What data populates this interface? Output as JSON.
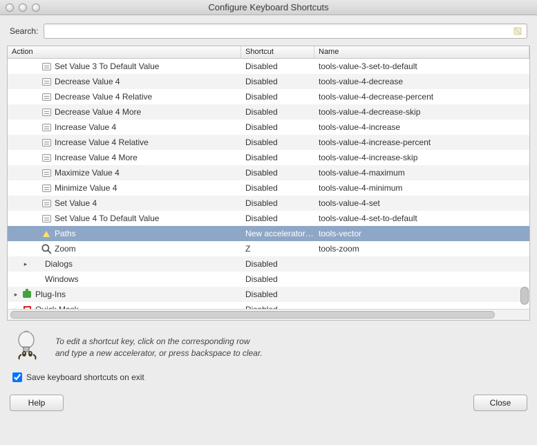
{
  "window": {
    "title": "Configure Keyboard Shortcuts"
  },
  "search": {
    "label": "Search:",
    "value": "",
    "placeholder": ""
  },
  "columns": {
    "action": "Action",
    "shortcut": "Shortcut",
    "name": "Name"
  },
  "rows": [
    {
      "indent": 2,
      "iconType": "kbd",
      "expander": "",
      "action": "Set Value 3 To Default Value",
      "shortcut": "Disabled",
      "name": "tools-value-3-set-to-default",
      "alt": false
    },
    {
      "indent": 2,
      "iconType": "kbd",
      "expander": "",
      "action": "Decrease Value 4",
      "shortcut": "Disabled",
      "name": "tools-value-4-decrease",
      "alt": true
    },
    {
      "indent": 2,
      "iconType": "kbd",
      "expander": "",
      "action": "Decrease Value 4 Relative",
      "shortcut": "Disabled",
      "name": "tools-value-4-decrease-percent",
      "alt": false
    },
    {
      "indent": 2,
      "iconType": "kbd",
      "expander": "",
      "action": "Decrease Value 4 More",
      "shortcut": "Disabled",
      "name": "tools-value-4-decrease-skip",
      "alt": true
    },
    {
      "indent": 2,
      "iconType": "kbd",
      "expander": "",
      "action": "Increase Value 4",
      "shortcut": "Disabled",
      "name": "tools-value-4-increase",
      "alt": false
    },
    {
      "indent": 2,
      "iconType": "kbd",
      "expander": "",
      "action": "Increase Value 4 Relative",
      "shortcut": "Disabled",
      "name": "tools-value-4-increase-percent",
      "alt": true
    },
    {
      "indent": 2,
      "iconType": "kbd",
      "expander": "",
      "action": "Increase Value 4 More",
      "shortcut": "Disabled",
      "name": "tools-value-4-increase-skip",
      "alt": false
    },
    {
      "indent": 2,
      "iconType": "kbd",
      "expander": "",
      "action": "Maximize Value 4",
      "shortcut": "Disabled",
      "name": "tools-value-4-maximum",
      "alt": true
    },
    {
      "indent": 2,
      "iconType": "kbd",
      "expander": "",
      "action": "Minimize Value 4",
      "shortcut": "Disabled",
      "name": "tools-value-4-minimum",
      "alt": false
    },
    {
      "indent": 2,
      "iconType": "kbd",
      "expander": "",
      "action": "Set Value 4",
      "shortcut": "Disabled",
      "name": "tools-value-4-set",
      "alt": true
    },
    {
      "indent": 2,
      "iconType": "kbd",
      "expander": "",
      "action": "Set Value 4 To Default Value",
      "shortcut": "Disabled",
      "name": "tools-value-4-set-to-default",
      "alt": false
    },
    {
      "indent": 2,
      "iconType": "paths",
      "expander": "",
      "action": "Paths",
      "shortcut": "New accelerator…",
      "name": "tools-vector",
      "alt": true,
      "selected": true
    },
    {
      "indent": 2,
      "iconType": "zoom",
      "expander": "",
      "action": "Zoom",
      "shortcut": "Z",
      "name": "tools-zoom",
      "alt": false
    },
    {
      "indent": 1,
      "iconType": "",
      "expander": "▸",
      "action": "Dialogs",
      "shortcut": "Disabled",
      "name": "",
      "alt": true
    },
    {
      "indent": 1,
      "iconType": "",
      "expander": "",
      "action": "Windows",
      "shortcut": "Disabled",
      "name": "",
      "alt": false
    },
    {
      "indent": 0,
      "iconType": "plugin",
      "expander": "▸",
      "action": "Plug-Ins",
      "shortcut": "Disabled",
      "name": "",
      "alt": true
    },
    {
      "indent": 0,
      "iconType": "quickmask",
      "expander": "▸",
      "action": "Quick Mask",
      "shortcut": "Disabled",
      "name": "",
      "alt": false
    }
  ],
  "hint": {
    "line1": "To edit a shortcut key, click on the corresponding row",
    "line2": "and type a new accelerator, or press backspace to clear."
  },
  "save": {
    "label": "Save keyboard shortcuts on exit",
    "checked": true
  },
  "buttons": {
    "help": "Help",
    "close": "Close"
  }
}
